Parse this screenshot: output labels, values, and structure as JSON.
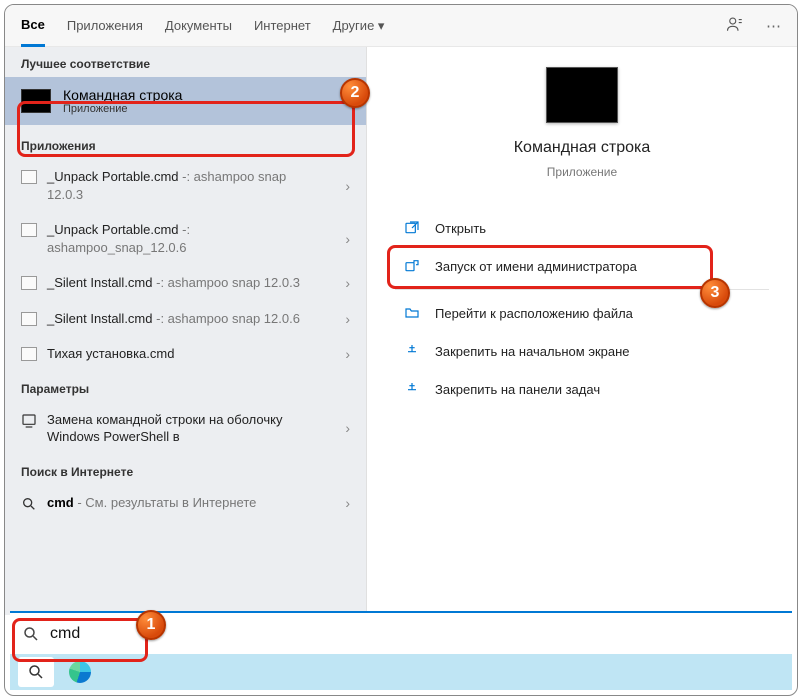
{
  "tabs": {
    "all": "Все",
    "apps": "Приложения",
    "docs": "Документы",
    "internet": "Интернет",
    "more": "Другие"
  },
  "sections": {
    "best": "Лучшее соответствие",
    "apps": "Приложения",
    "settings": "Параметры",
    "web": "Поиск в Интернете"
  },
  "best_match": {
    "title": "Командная строка",
    "subtitle": "Приложение"
  },
  "apps": [
    {
      "name": "_Unpack Portable.cmd",
      "hint": " -: ashampoo snap 12.0.3"
    },
    {
      "name": "_Unpack Portable.cmd",
      "hint": " -: ashampoo_snap_12.0.6"
    },
    {
      "name": "_Silent Install.cmd",
      "hint": " -: ashampoo snap 12.0.3"
    },
    {
      "name": "_Silent Install.cmd",
      "hint": " -: ashampoo snap 12.0.6"
    },
    {
      "name": "Тихая установка.cmd",
      "hint": ""
    }
  ],
  "settings": [
    {
      "text": "Замена командной строки на оболочку Windows PowerShell в"
    }
  ],
  "web": {
    "query": "cmd",
    "suffix": " - См. результаты в Интернете"
  },
  "preview": {
    "title": "Командная строка",
    "subtitle": "Приложение"
  },
  "actions": {
    "open": "Открыть",
    "admin": "Запуск от имени администратора",
    "location": "Перейти к расположению файла",
    "pin_start": "Закрепить на начальном экране",
    "pin_task": "Закрепить на панели задач"
  },
  "search": {
    "value": "cmd"
  },
  "badges": {
    "b1": "1",
    "b2": "2",
    "b3": "3"
  }
}
